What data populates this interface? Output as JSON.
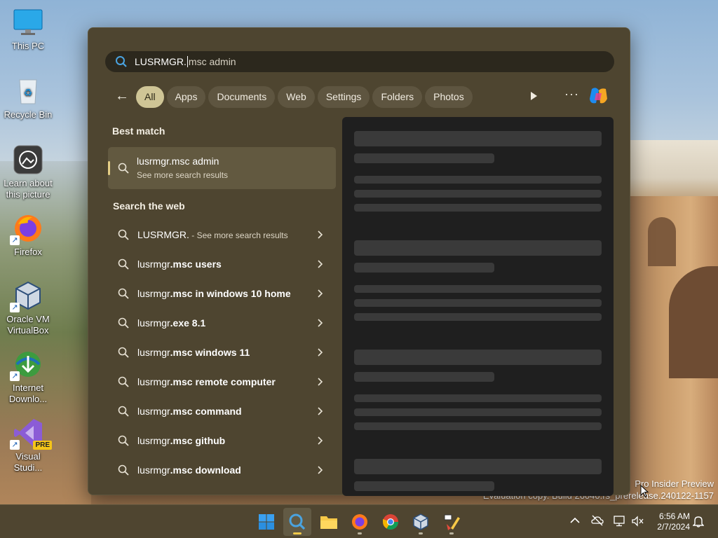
{
  "desktop": {
    "icons": [
      {
        "name": "this-pc",
        "label": "This PC"
      },
      {
        "name": "recycle-bin",
        "label": "Recycle Bin"
      },
      {
        "name": "learn-about-picture",
        "label": "Learn about this picture"
      },
      {
        "name": "firefox",
        "label": "Firefox"
      },
      {
        "name": "oracle-vm-virtualbox",
        "label": "Oracle VM VirtualBox"
      },
      {
        "name": "internet-download-manager",
        "label": "Internet Downlo..."
      },
      {
        "name": "visual-studio",
        "label": "Visual Studi..."
      }
    ],
    "pre_badge": "PRE"
  },
  "search": {
    "query_typed": "LUSRMGR.",
    "query_rest": "msc admin",
    "filters": [
      "All",
      "Apps",
      "Documents",
      "Web",
      "Settings",
      "Folders",
      "Photos"
    ],
    "active_filter": "All",
    "more_label": "···",
    "best_match_heading": "Best match",
    "best_match": {
      "title": "lusrmgr.msc admin",
      "subtitle": "See more search results"
    },
    "web_heading": "Search the web",
    "web_results": [
      {
        "prefix": "LUSRMGR.",
        "suffix": "",
        "hint": " - See more search results"
      },
      {
        "prefix": "lusrmgr",
        "suffix": ".msc users",
        "hint": ""
      },
      {
        "prefix": "lusrmgr",
        "suffix": ".msc in windows 10 home",
        "hint": ""
      },
      {
        "prefix": "lusrmgr",
        "suffix": ".exe 8.1",
        "hint": ""
      },
      {
        "prefix": "lusrmgr",
        "suffix": ".msc windows 11",
        "hint": ""
      },
      {
        "prefix": "lusrmgr",
        "suffix": ".msc remote computer",
        "hint": ""
      },
      {
        "prefix": "lusrmgr",
        "suffix": ".msc command",
        "hint": ""
      },
      {
        "prefix": "lusrmgr",
        "suffix": ".msc github",
        "hint": ""
      },
      {
        "prefix": "lusrmgr",
        "suffix": ".msc download",
        "hint": ""
      }
    ]
  },
  "watermark": {
    "line1": "Pro Insider Preview",
    "line2": "Evaluation copy. Build 26040.rs_prerelease.240122-1157"
  },
  "taskbar": {
    "apps": [
      "start-icon",
      "search-icon",
      "file-explorer-icon",
      "firefox-icon",
      "chrome-icon",
      "virtualbox-icon",
      "paint-icon"
    ],
    "time": "6:56 AM",
    "date": "2/7/2024"
  },
  "colors": {
    "flyout_bg": "#4e4530",
    "chip_active": "#cfc596",
    "accent": "#e6cf86",
    "preview_bg": "#1f1f1f"
  }
}
